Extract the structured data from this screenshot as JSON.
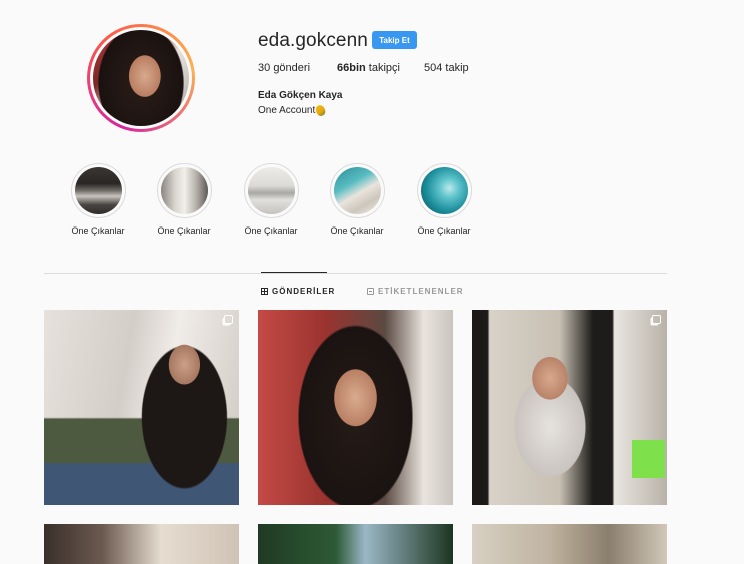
{
  "profile": {
    "username": "eda.gokcenn",
    "follow_label": "Takip Et",
    "stats": {
      "posts_value": "30",
      "posts_label": "gönderi",
      "followers_value": "66bin",
      "followers_label": "takipçi",
      "following_value": "504",
      "following_label": "takip"
    },
    "full_name": "Eda Gökçen Kaya",
    "bio": "One Account",
    "bio_emoji": "pineapple-emoji"
  },
  "highlights": [
    {
      "label": "Öne Çıkanlar",
      "image": "room-interior"
    },
    {
      "label": "Öne Çıkanlar",
      "image": "bright-room"
    },
    {
      "label": "Öne Çıkanlar",
      "image": "white-furniture"
    },
    {
      "label": "Öne Çıkanlar",
      "image": "pool-deck"
    },
    {
      "label": "Öne Çıkanlar",
      "image": "ocean-waves"
    }
  ],
  "tabs": {
    "posts_label": "GÖNDERİLER",
    "tagged_label": "ETİKETLENENLER",
    "posts_icon": "grid-icon",
    "tagged_icon": "tag-icon"
  },
  "posts": [
    {
      "description": "mirror-selfie",
      "multi": true
    },
    {
      "description": "car-selfie",
      "multi": false
    },
    {
      "description": "mirror-selfie-room",
      "multi": true
    },
    {
      "description": "post-row2-1",
      "multi": false
    },
    {
      "description": "post-row2-2",
      "multi": false
    },
    {
      "description": "post-row2-3",
      "multi": false
    }
  ],
  "colors": {
    "accent": "#3897f0",
    "text": "#262626",
    "muted": "#999999",
    "border": "#dbdbdb",
    "background": "#fafafa"
  }
}
